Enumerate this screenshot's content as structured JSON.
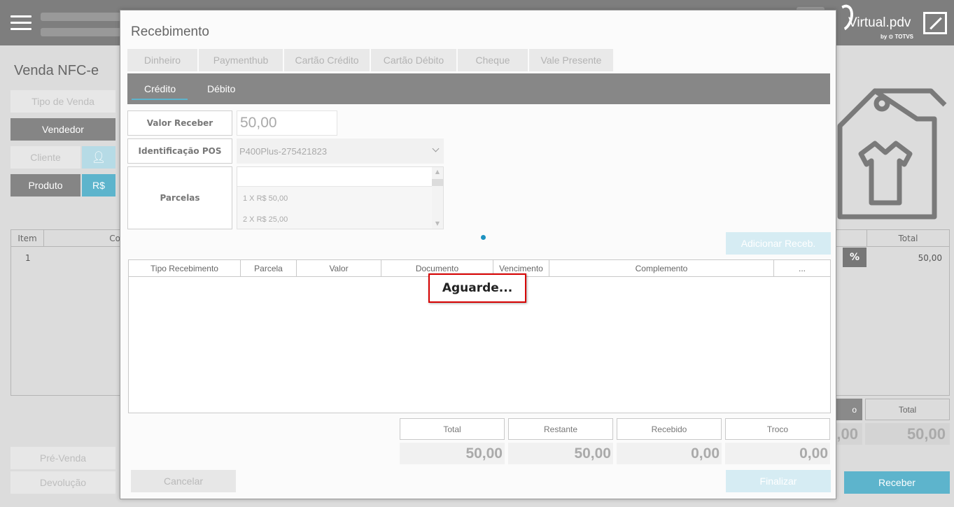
{
  "app": {
    "logo_text": "Virtual.pdv",
    "logo_by": "by ⊙ TOTVS"
  },
  "page": {
    "title": "Venda NFC-e",
    "buttons": {
      "tipo_venda": "Tipo de Venda",
      "vendedor": "Vendedor",
      "cliente": "Cliente",
      "produto": "Produto",
      "currency": "R$",
      "pre_venda": "Pré-Venda",
      "devolucao": "Devolução",
      "receber": "Receber"
    },
    "items_table": {
      "columns": [
        "Item",
        "Co"
      ],
      "rows": [
        {
          "item": "1"
        }
      ]
    },
    "right_table": {
      "column_total": "Total",
      "row_total": "50,00",
      "discount_icon": "percent-icon"
    },
    "totals": {
      "left_value_partial": ",00",
      "total_label": "Total",
      "total_value": "50,00",
      "left_label_partial": "o"
    }
  },
  "modal": {
    "title": "Recebimento",
    "payment_tabs": [
      "Dinheiro",
      "Paymenthub",
      "Cartão Crédito",
      "Cartão Débito",
      "Cheque",
      "Vale Presente"
    ],
    "sub_tabs": [
      "Crédito",
      "Débito"
    ],
    "active_sub_tab": "Crédito",
    "form": {
      "valor_receber_label": "Valor Receber",
      "valor_receber_value": "50,00",
      "identificacao_pos_label": "Identificação POS",
      "identificacao_pos_value": "P400Plus-275421823",
      "parcelas_label": "Parcelas",
      "parcelas_options": [
        "1 X R$ 50,00",
        "2 X R$ 25,00"
      ]
    },
    "add_button": "Adicionar Receb.",
    "grid_columns": [
      "Tipo Recebimento",
      "Parcela",
      "Valor",
      "Documento",
      "Vencimento",
      "Complemento",
      "..."
    ],
    "loading_text": "Aguarde...",
    "summary": [
      {
        "label": "Total",
        "value": "50,00"
      },
      {
        "label": "Restante",
        "value": "50,00"
      },
      {
        "label": "Recebido",
        "value": "0,00"
      },
      {
        "label": "Troco",
        "value": "0,00"
      }
    ],
    "cancel_button": "Cancelar",
    "finalize_button": "Finalizar"
  },
  "colors": {
    "topbar": "#7e7e7e",
    "accent": "#5db4cc",
    "loading_border": "#d60000"
  }
}
